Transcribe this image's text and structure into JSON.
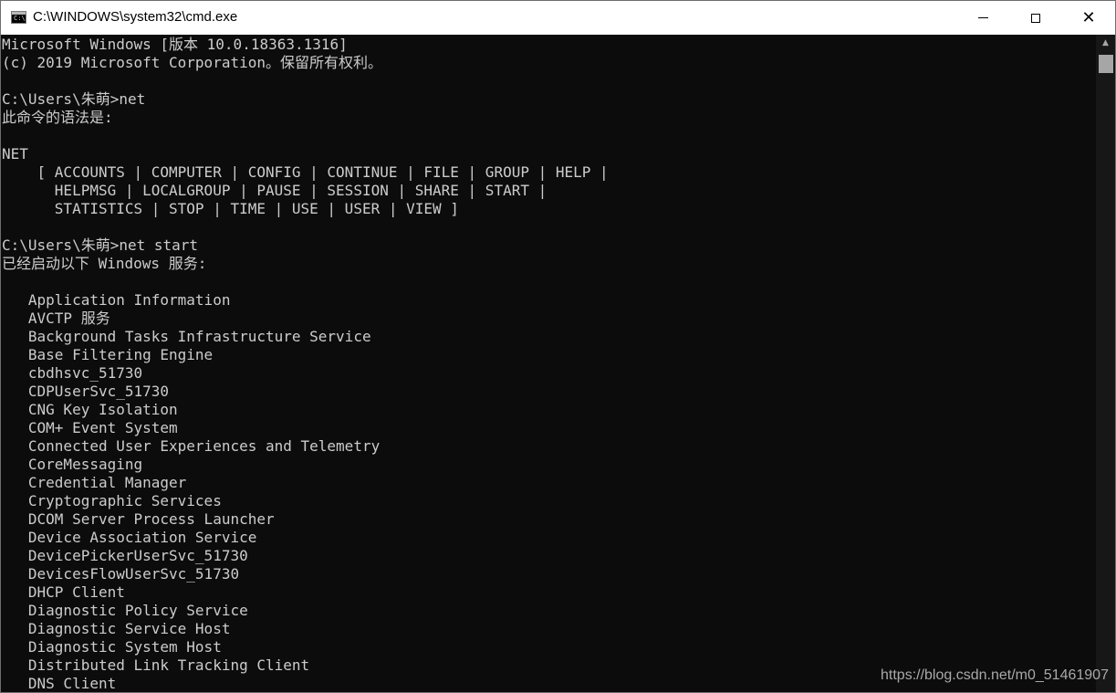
{
  "window": {
    "title": "C:\\WINDOWS\\system32\\cmd.exe",
    "icon": "cmd-icon",
    "icon_text": "C:\\",
    "controls": {
      "minimize": "minimize-icon",
      "maximize": "maximize-icon",
      "close": "close-icon"
    }
  },
  "console": {
    "lines": [
      "Microsoft Windows [版本 10.0.18363.1316]",
      "(c) 2019 Microsoft Corporation。保留所有权利。",
      "",
      "C:\\Users\\朱萌>net",
      "此命令的语法是:",
      "",
      "NET",
      "    [ ACCOUNTS | COMPUTER | CONFIG | CONTINUE | FILE | GROUP | HELP |",
      "      HELPMSG | LOCALGROUP | PAUSE | SESSION | SHARE | START |",
      "      STATISTICS | STOP | TIME | USE | USER | VIEW ]",
      "",
      "C:\\Users\\朱萌>net start",
      "已经启动以下 Windows 服务:",
      "",
      "   Application Information",
      "   AVCTP 服务",
      "   Background Tasks Infrastructure Service",
      "   Base Filtering Engine",
      "   cbdhsvc_51730",
      "   CDPUserSvc_51730",
      "   CNG Key Isolation",
      "   COM+ Event System",
      "   Connected User Experiences and Telemetry",
      "   CoreMessaging",
      "   Credential Manager",
      "   Cryptographic Services",
      "   DCOM Server Process Launcher",
      "   Device Association Service",
      "   DevicePickerUserSvc_51730",
      "   DevicesFlowUserSvc_51730",
      "   DHCP Client",
      "   Diagnostic Policy Service",
      "   Diagnostic Service Host",
      "   Diagnostic System Host",
      "   Distributed Link Tracking Client",
      "   DNS Client"
    ]
  },
  "scrollbar": {
    "up_arrow": "▲",
    "icon": "scroll-up-arrow-icon"
  },
  "watermark": "https://blog.csdn.net/m0_51461907",
  "colors": {
    "background": "#0c0c0c",
    "text": "#cccccc",
    "titlebar": "#ffffff"
  }
}
